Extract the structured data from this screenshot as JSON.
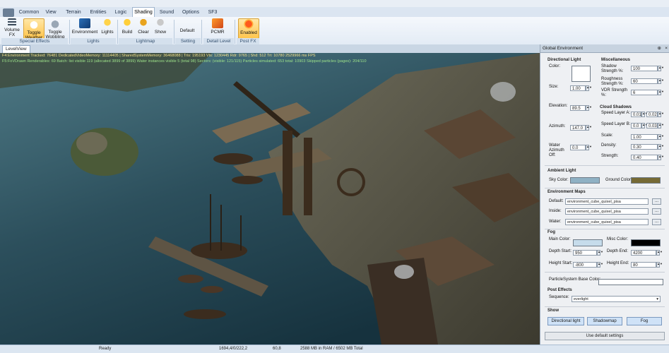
{
  "tabs": [
    "Common",
    "View",
    "Terrain",
    "Entities",
    "Logic",
    "Shading",
    "Sound",
    "Options",
    "SF3"
  ],
  "active_tab": "Shading",
  "ribbon": {
    "buttons": [
      {
        "label": "Volume FX",
        "icon": "volume-fx-icon"
      },
      {
        "label": "Toggle Weather",
        "icon": "cloud-icon"
      },
      {
        "label": "Toggle Wobbling",
        "icon": "cloud-icon"
      },
      {
        "label": "Environment",
        "icon": "globe-icon"
      },
      {
        "label": "Lights",
        "icon": "bulb-icon"
      },
      {
        "label": "Build",
        "icon": "bulb-icon"
      },
      {
        "label": "Clear",
        "icon": "bulb-icon"
      },
      {
        "label": "Show",
        "icon": "bulb-icon"
      },
      {
        "label": "Default",
        "icon": "none"
      },
      {
        "label": "PCMR",
        "icon": "flame-icon"
      },
      {
        "label": "Enabled",
        "icon": "flame-icon"
      }
    ],
    "groups": [
      "Special Effects",
      "Lights",
      "Lightmap",
      "Setting",
      "Detail Level",
      "Post FX"
    ]
  },
  "level_view": {
    "tab": "LevelView",
    "stats": [
      "F4:Environment  Tracked: 76481  DedicatedVideoMemory: 11114405 | SharedSystemMemory: 36468088 | Tris: 195193  Vts: 1230445  Rdr: 9765 | Shd: 512 Tri: 10780 2529966 ms FPS",
      "F5:FoVDrawn  Renderables: 69  Batch: list visible 119 (allocated 3899 of 3899)  Water instances visible 5 (total 98)  Sectors: (visible: 121/115)  Particles simulated: 653 total: 10903  Skipped particles (pages): 204/110"
    ]
  },
  "panel": {
    "title": "Global Environment",
    "directional_light": {
      "title": "Directional Light",
      "color_label": "Color:",
      "size_label": "Size:",
      "size": "1.00",
      "elevation_label": "Elevation:",
      "elevation": "89.5",
      "azimuth_label": "Azimuth:",
      "azimuth": "147.0",
      "water_azimuth_label": "Water Azimuth Off:",
      "water_azimuth": "0.0"
    },
    "misc": {
      "title": "Miscellaneous",
      "shadow_label": "Shadow Strength %:",
      "shadow": "100",
      "roughness_label": "Roughness Strength %:",
      "roughness": "60",
      "vdr_label": "VDR Strength %:",
      "vdr": "6"
    },
    "cloud": {
      "title": "Cloud Shadows",
      "speed_a_label": "Speed Layer A:",
      "speed_a": [
        "0.01",
        "0.02"
      ],
      "speed_b_label": "Speed Layer B:",
      "speed_b": [
        "0.0",
        "0.03"
      ],
      "scale_label": "Scale:",
      "scale": "1.00",
      "density_label": "Density:",
      "density": "0.30",
      "strength_label": "Strength:",
      "strength": "0.40"
    },
    "ambient": {
      "title": "Ambient Light",
      "sky_label": "Sky Color:",
      "sky_color": "#8fb1c4",
      "ground_label": "Ground Color:",
      "ground_color": "#766a35"
    },
    "env_maps": {
      "title": "Environment Maps",
      "default_label": "Default:",
      "default": "environment_cube_quixel_pisa",
      "inside_label": "Inside:",
      "inside": "environment_cube_quixel_pisa",
      "water_label": "Water:",
      "water": "environment_cube_quixel_pisa",
      "browse": "..."
    },
    "fog": {
      "title": "Fog",
      "main_label": "Main Color:",
      "main_color": "#c6dceb",
      "misc_label": "Misc Color:",
      "misc_color": "#000000",
      "depth_start_label": "Depth Start:",
      "depth_start": "950",
      "depth_end_label": "Depth End:",
      "depth_end": "4200",
      "height_start_label": "Height Start:",
      "height_start": "-800",
      "height_end_label": "Height End:",
      "height_end": "80"
    },
    "particle_label": "ParticleSystem Base Color:",
    "post": {
      "title": "Post Effects",
      "sequence_label": "Sequence:",
      "sequence": "everlight"
    },
    "show": {
      "title": "Show",
      "buttons": [
        "Directional light",
        "Shadowmap",
        "Fog"
      ]
    },
    "default_button": "Use default settings"
  },
  "status": {
    "state": "Ready",
    "coords": "1694,4/0/222,2",
    "fps": "60,8",
    "memory": "2588 MB in RAM / 6502 MB Total"
  }
}
